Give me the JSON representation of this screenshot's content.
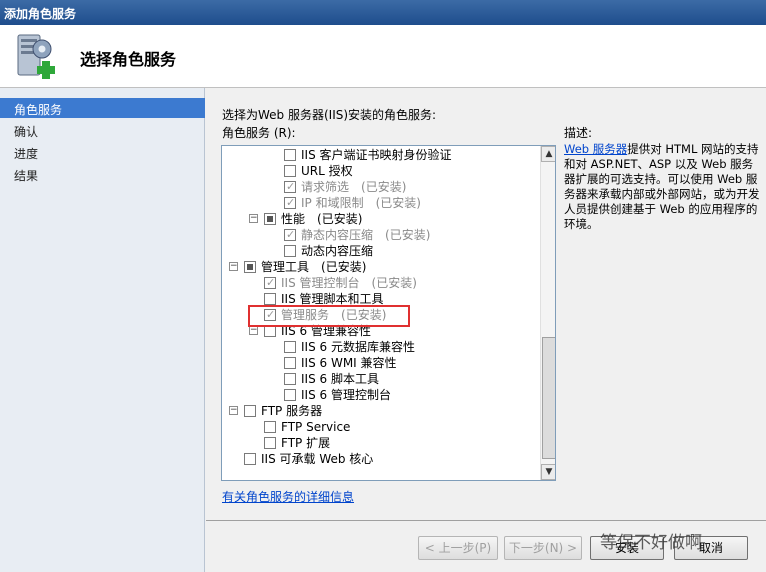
{
  "window": {
    "title": "添加角色服务"
  },
  "header": {
    "title": "选择角色服务",
    "icon": "server-role-add-icon"
  },
  "sidebar": {
    "items": [
      {
        "label": "角色服务",
        "active": true
      },
      {
        "label": "确认",
        "active": false
      },
      {
        "label": "进度",
        "active": false
      },
      {
        "label": "结果",
        "active": false
      }
    ]
  },
  "main": {
    "intro": "选择为Web 服务器(IIS)安装的角色服务:",
    "roles_label": "角色服务 (R):",
    "tree": [
      {
        "label": "IIS 客户端证书映射身份验证",
        "installed": "",
        "state": "unchecked",
        "disabled": false
      },
      {
        "label": "URL 授权",
        "installed": "",
        "state": "unchecked",
        "disabled": false
      },
      {
        "label": "请求筛选",
        "installed": "(已安装)",
        "state": "checked",
        "disabled": true
      },
      {
        "label": "IP 和域限制",
        "installed": "(已安装)",
        "state": "checked",
        "disabled": true
      },
      {
        "label": "性能",
        "installed": "(已安装)",
        "state": "partial",
        "disabled": false
      },
      {
        "label": "静态内容压缩",
        "installed": "(已安装)",
        "state": "checked",
        "disabled": true
      },
      {
        "label": "动态内容压缩",
        "installed": "",
        "state": "unchecked",
        "disabled": false
      },
      {
        "label": "管理工具",
        "installed": "(已安装)",
        "state": "partial",
        "disabled": false
      },
      {
        "label": "IIS 管理控制台",
        "installed": "(已安装)",
        "state": "checked",
        "disabled": true
      },
      {
        "label": "IIS 管理脚本和工具",
        "installed": "",
        "state": "unchecked",
        "disabled": false
      },
      {
        "label": "管理服务",
        "installed": "(已安装)",
        "state": "checked",
        "disabled": true
      },
      {
        "label": "IIS 6 管理兼容性",
        "installed": "",
        "state": "unchecked",
        "disabled": false
      },
      {
        "label": "IIS 6 元数据库兼容性",
        "installed": "",
        "state": "unchecked",
        "disabled": false
      },
      {
        "label": "IIS 6 WMI 兼容性",
        "installed": "",
        "state": "unchecked",
        "disabled": false
      },
      {
        "label": "IIS 6 脚本工具",
        "installed": "",
        "state": "unchecked",
        "disabled": false
      },
      {
        "label": "IIS 6 管理控制台",
        "installed": "",
        "state": "unchecked",
        "disabled": false
      },
      {
        "label": "FTP 服务器",
        "installed": "",
        "state": "unchecked",
        "disabled": false
      },
      {
        "label": "FTP Service",
        "installed": "",
        "state": "unchecked",
        "disabled": false
      },
      {
        "label": "FTP 扩展",
        "installed": "",
        "state": "unchecked",
        "disabled": false
      },
      {
        "label": "IIS 可承载 Web 核心",
        "installed": "",
        "state": "unchecked",
        "disabled": false
      }
    ],
    "description": {
      "label": "描述:",
      "link": "Web 服务器",
      "text": "提供对 HTML 网站的支持和对 ASP.NET、ASP 以及 Web 服务器扩展的可选支持。可以使用 Web 服务器来承载内部或外部网站，或为开发人员提供创建基于 Web 的应用程序的环境。"
    },
    "more_link": "有关角色服务的详细信息"
  },
  "buttons": {
    "prev": "< 上一步(P)",
    "next": "下一步(N) >",
    "install": "安装",
    "cancel": "取消"
  },
  "watermark": "等保不好做啊"
}
